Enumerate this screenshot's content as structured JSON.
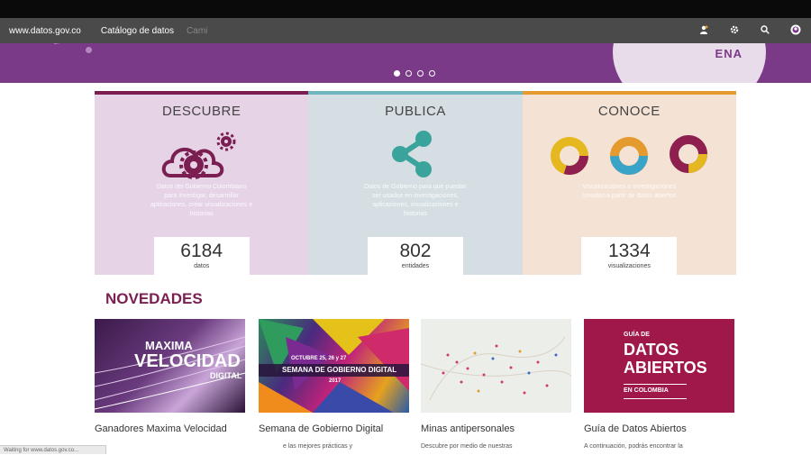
{
  "nav": {
    "brand": "www.datos.gov.co",
    "catalog": "Catálogo de datos",
    "search_ghost": "Cami",
    "icons": [
      "user-icon",
      "gear-icon",
      "search-icon",
      "globe-icon"
    ]
  },
  "hero": {
    "badge_text": "ENA",
    "carousel_count": 4,
    "active_slide": 1
  },
  "panels": [
    {
      "title": "DESCUBRE",
      "description": "Datos del Gobierno Colombiano para investigar, desarrollar aplicaciones, crear visualizaciones e historias",
      "count": "6184",
      "count_label": "datos",
      "icon": "cloud-gears-icon"
    },
    {
      "title": "PUBLICA",
      "description": "Datos de Gobierno para que puedan ser usados en investigaciones, aplicaciones, visualizaciones e historias",
      "count": "802",
      "count_label": "entidades",
      "icon": "share-icon"
    },
    {
      "title": "CONOCE",
      "description": "Visualizaciones e investigaciones creadas a partir de datos abiertos",
      "count": "1334",
      "count_label": "visualizaciones",
      "icon": "donut-charts-icon"
    }
  ],
  "colors": {
    "accent": "#7b1f52",
    "hero": "#7b3a87",
    "descubre": "#e6d3e6",
    "publica": "#d5dfe3",
    "conoce": "#f4e3d4"
  },
  "novedades": {
    "title": "NOVEDADES",
    "cards": [
      {
        "title": "Ganadores Maxima Velocidad",
        "image_text": [
          "MAXIMA",
          "VELOCIDAD",
          "DIGITAL"
        ]
      },
      {
        "title": "Semana de Gobierno Digital",
        "image_text": [
          "OCTUBRE 25, 26 y 27",
          "SEMANA DE GOBIERNO DIGITAL",
          "2017"
        ],
        "snippet": "e  las  mejores  prácticas  y"
      },
      {
        "title": "Minas antipersonales",
        "snippet": "Descubre  por  medio  de  nuestras"
      },
      {
        "title": "Guía de Datos Abiertos",
        "image_text": [
          "GUÍA DE",
          "DATOS",
          "ABIERTOS",
          "EN COLOMBIA"
        ],
        "snippet": "A  continuación,  podrás  encontrar  la"
      }
    ]
  },
  "statusbar": "Waiting for www.datos.gov.co..."
}
